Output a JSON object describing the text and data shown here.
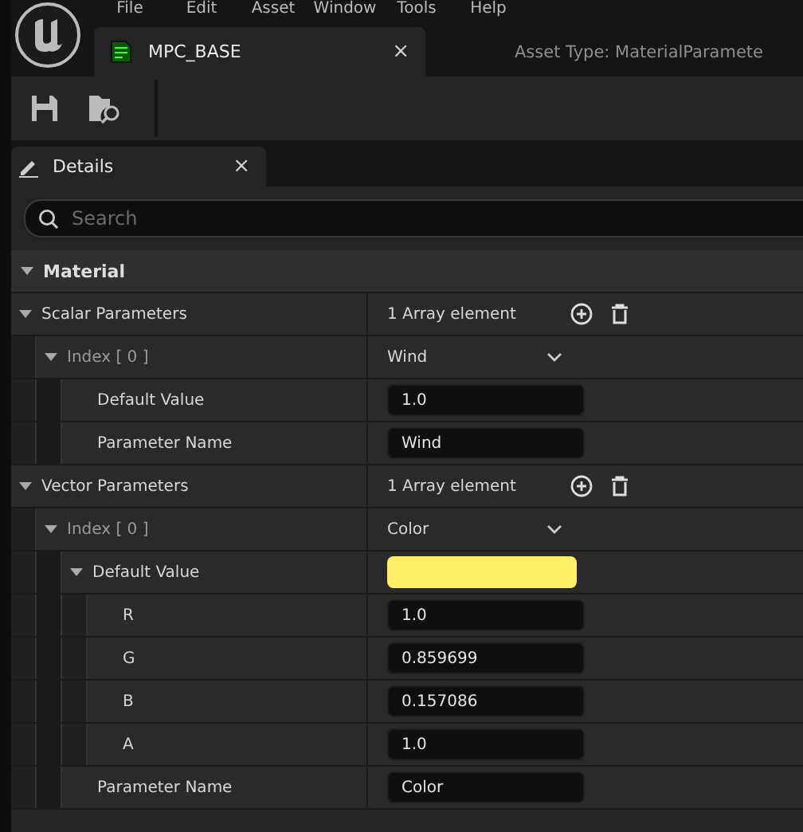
{
  "menu": [
    "File",
    "Edit",
    "Asset",
    "Window",
    "Tools",
    "Help"
  ],
  "document_tab": {
    "title": "MPC_BASE",
    "close": "×"
  },
  "asset_type": "Asset Type: MaterialParamete",
  "panel_tab": {
    "title": "Details",
    "close": "×"
  },
  "search": {
    "placeholder": "Search"
  },
  "category": {
    "title": "Material",
    "expanded": true
  },
  "properties": [
    {
      "kind": "array",
      "label": "Scalar Parameters",
      "value": "1 Array element",
      "expanded": true,
      "children": [
        {
          "kind": "combo",
          "label": "Index [ 0 ]",
          "value": "Wind",
          "expanded": true,
          "children": [
            {
              "kind": "field",
              "label": "Default Value",
              "value": "1.0"
            },
            {
              "kind": "field",
              "label": "Parameter Name",
              "value": "Wind"
            }
          ]
        }
      ]
    },
    {
      "kind": "array",
      "label": "Vector Parameters",
      "value": "1 Array element",
      "expanded": true,
      "children": [
        {
          "kind": "combo",
          "label": "Index [ 0 ]",
          "value": "Color",
          "expanded": true,
          "children": [
            {
              "kind": "color",
              "label": "Default Value",
              "color": "#ffee6a",
              "expanded": true,
              "children": [
                {
                  "kind": "field",
                  "label": "R",
                  "value": "1.0"
                },
                {
                  "kind": "field",
                  "label": "G",
                  "value": "0.859699"
                },
                {
                  "kind": "field",
                  "label": "B",
                  "value": "0.157086"
                },
                {
                  "kind": "field",
                  "label": "A",
                  "value": "1.0"
                }
              ]
            },
            {
              "kind": "field",
              "label": "Parameter Name",
              "value": "Color"
            }
          ]
        }
      ]
    }
  ]
}
